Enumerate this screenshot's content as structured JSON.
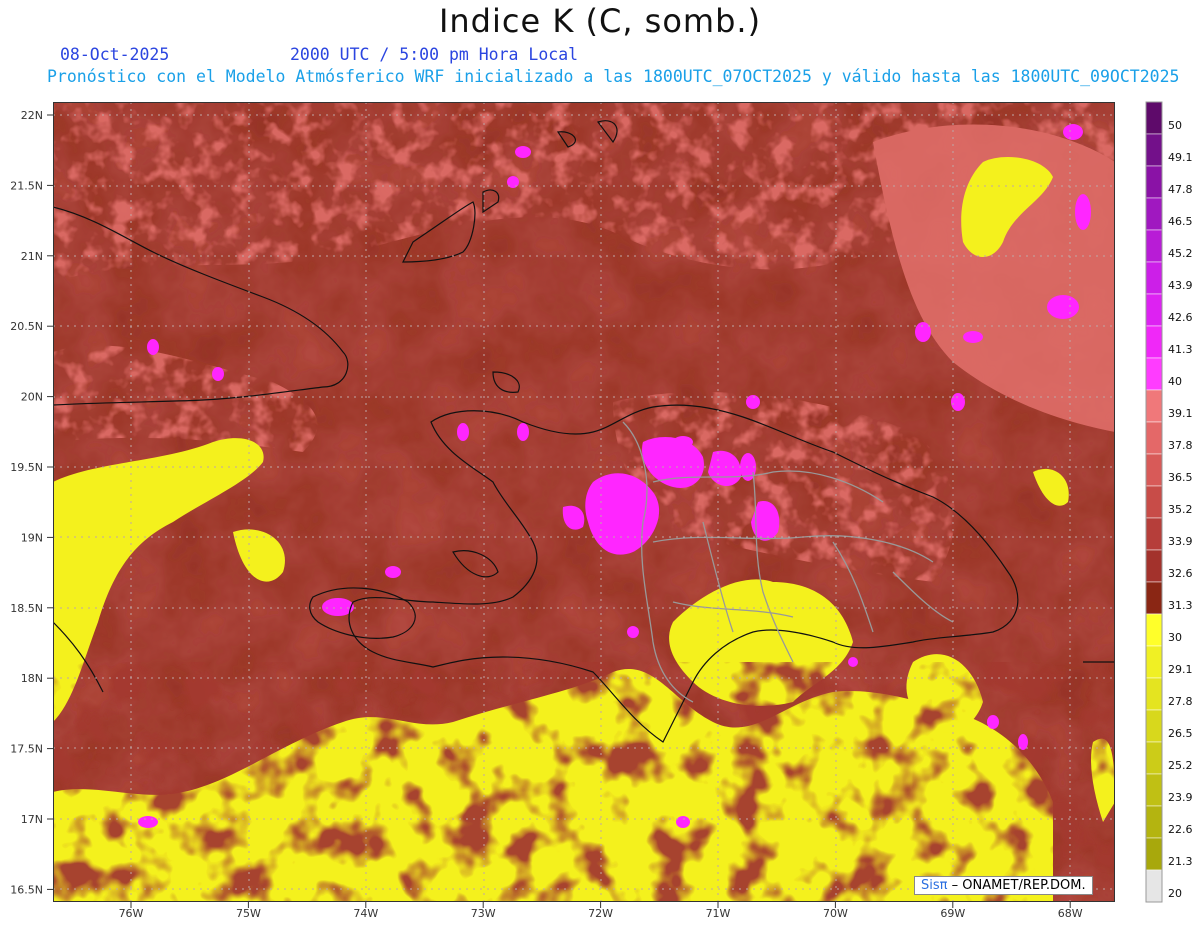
{
  "header": {
    "title": "Indice K (C, somb.)",
    "date": "08-Oct-2025",
    "time": "2000 UTC / 5:00 pm Hora Local",
    "description": "Pronóstico con el Modelo Atmósferico WRF inicializado a las 1800UTC_07OCT2025 y válido hasta las  1800UTC_09OCT2025"
  },
  "axes": {
    "lat_labels": [
      "22N",
      "21.5N",
      "21N",
      "20.5N",
      "20N",
      "19.5N",
      "19N",
      "18.5N",
      "18N",
      "17.5N",
      "17N",
      "16.5N"
    ],
    "lon_labels": [
      "76W",
      "75W",
      "74W",
      "73W",
      "72W",
      "71W",
      "70W",
      "69W",
      "68W"
    ]
  },
  "legend": {
    "levels": [
      "50",
      "49.1",
      "47.8",
      "46.5",
      "45.2",
      "43.9",
      "42.6",
      "41.3",
      "40",
      "39.1",
      "37.8",
      "36.5",
      "35.2",
      "33.9",
      "32.6",
      "31.3",
      "30",
      "29.1",
      "27.8",
      "26.5",
      "25.2",
      "23.9",
      "22.6",
      "21.3",
      "20"
    ],
    "colors": [
      "#5e0a6a",
      "#73108a",
      "#8a12a6",
      "#a018c0",
      "#b81cd6",
      "#cc1fe8",
      "#dd22f2",
      "#f028f8",
      "#ff3cff",
      "#f0787a",
      "#e46868",
      "#d85a58",
      "#c84c48",
      "#b63e3a",
      "#a3322c",
      "#8a2614",
      "#ffff2a",
      "#f0f024",
      "#e4e420",
      "#d8d81c",
      "#cccc18",
      "#c0c014",
      "#b4b410",
      "#a8a80c",
      "#e6e6e6"
    ]
  },
  "credit": {
    "symbol": "Sisπ",
    "text": "– ONAMET/REP.DOM."
  }
}
